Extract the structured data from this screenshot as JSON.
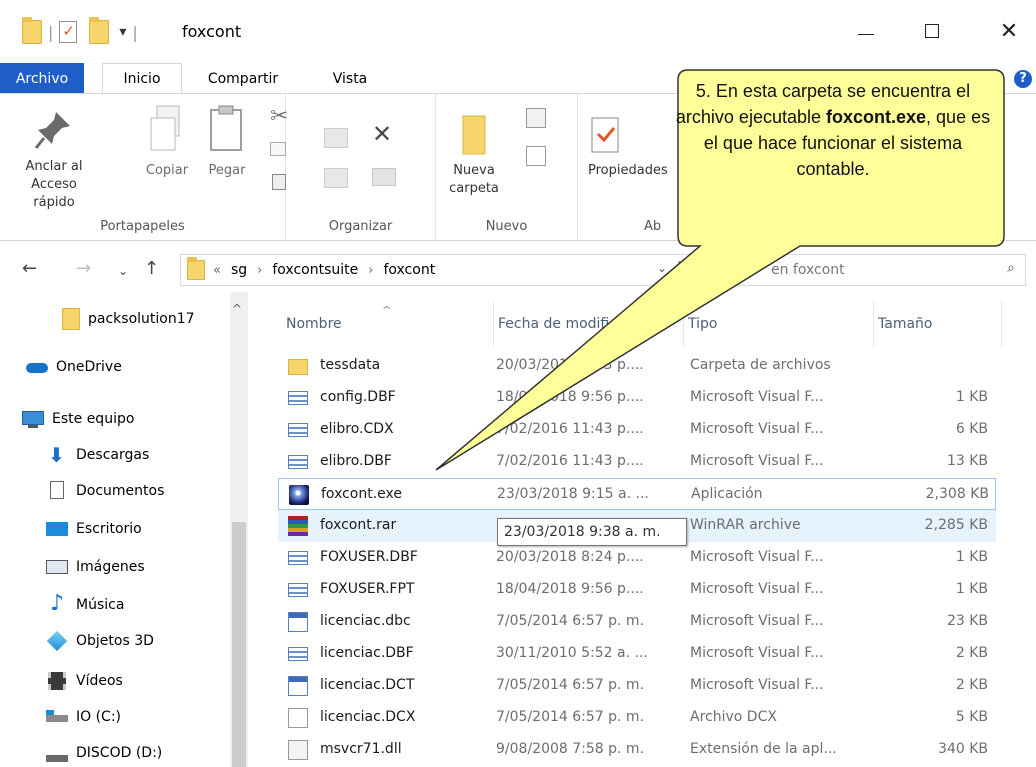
{
  "window": {
    "title": "foxcont",
    "qa_dropdown": "▾"
  },
  "tabs": [
    "Archivo",
    "Inicio",
    "Compartir",
    "Vista"
  ],
  "ribbon": {
    "pin_label_1": "Anclar al",
    "pin_label_2": "Acceso rápido",
    "copy": "Copiar",
    "paste": "Pegar",
    "group_clipboard": "Portapapeles",
    "group_organize": "Organizar",
    "new_folder_1": "Nueva",
    "new_folder_2": "carpeta",
    "group_new": "Nuevo",
    "properties": "Propiedades",
    "group_open_partial": "Ab"
  },
  "address": {
    "overflow": "«",
    "crumbs": [
      "sg",
      "foxcontsuite",
      "foxcont"
    ],
    "search_placeholder": "en foxcont"
  },
  "nav": [
    {
      "label": "packsolution17",
      "icon": "folder-icon"
    },
    {
      "label": "OneDrive",
      "icon": "cloud-icon"
    },
    {
      "label": "Este equipo",
      "icon": "computer-icon"
    },
    {
      "label": "Descargas",
      "icon": "download-icon"
    },
    {
      "label": "Documentos",
      "icon": "documents-icon"
    },
    {
      "label": "Escritorio",
      "icon": "desktop-icon"
    },
    {
      "label": "Imágenes",
      "icon": "pictures-icon"
    },
    {
      "label": "Música",
      "icon": "music-icon"
    },
    {
      "label": "Objetos 3D",
      "icon": "3d-objects-icon"
    },
    {
      "label": "Vídeos",
      "icon": "videos-icon"
    },
    {
      "label": "IO (C:)",
      "icon": "drive-icon"
    },
    {
      "label": "DISCOD (D:)",
      "icon": "drive-icon"
    }
  ],
  "columns": {
    "name": "Nombre",
    "date": "Fecha de modifi",
    "type": "Tipo",
    "size": "Tamaño"
  },
  "files": [
    {
      "name": "tessdata",
      "date": "20/03/2018 8:23 p....",
      "type": "Carpeta de archivos",
      "size": "",
      "icon": "folder"
    },
    {
      "name": "config.DBF",
      "date": "18/04/2018 9:56 p....",
      "type": "Microsoft Visual F...",
      "size": "1 KB",
      "icon": "dbf"
    },
    {
      "name": "elibro.CDX",
      "date": "7/02/2016 11:43 p....",
      "type": "Microsoft Visual F...",
      "size": "6 KB",
      "icon": "dbf"
    },
    {
      "name": "elibro.DBF",
      "date": "7/02/2016 11:43 p....",
      "type": "Microsoft Visual F...",
      "size": "13 KB",
      "icon": "dbf"
    },
    {
      "name": "foxcont.exe",
      "date": "23/03/2018 9:15 a. ...",
      "type": "Aplicación",
      "size": "2,308 KB",
      "icon": "exe"
    },
    {
      "name": "foxcont.rar",
      "date": "23/03/2018 9:38 a. m.",
      "type": "WinRAR archive",
      "size": "2,285 KB",
      "icon": "rar"
    },
    {
      "name": "FOXUSER.DBF",
      "date": "20/03/2018 8:24 p....",
      "type": "Microsoft Visual F...",
      "size": "1 KB",
      "icon": "dbf"
    },
    {
      "name": "FOXUSER.FPT",
      "date": "18/04/2018 9:56 p....",
      "type": "Microsoft Visual F...",
      "size": "1 KB",
      "icon": "dbf"
    },
    {
      "name": "licenciac.dbc",
      "date": "7/05/2014 6:57 p. m.",
      "type": "Microsoft Visual F...",
      "size": "23 KB",
      "icon": "dbc"
    },
    {
      "name": "licenciac.DBF",
      "date": "30/11/2010 5:52 a. ...",
      "type": "Microsoft Visual F...",
      "size": "2 KB",
      "icon": "dbf"
    },
    {
      "name": "licenciac.DCT",
      "date": "7/05/2014 6:57 p. m.",
      "type": "Microsoft Visual F...",
      "size": "2 KB",
      "icon": "dbc"
    },
    {
      "name": "licenciac.DCX",
      "date": "7/05/2014 6:57 p. m.",
      "type": "Archivo DCX",
      "size": "5 KB",
      "icon": "dcx"
    },
    {
      "name": "msvcr71.dll",
      "date": "9/08/2008 7:58 p. m.",
      "type": "Extensión de la apl...",
      "size": "340 KB",
      "icon": "dll"
    }
  ],
  "tooltip": "23/03/2018 9:38 a. m.",
  "callout": {
    "line1": "5. En esta carpeta se encuentra el archivo ejecutable",
    "bold": "foxcont.exe",
    "line2": ", que es el que hace funcionar el sistema contable.",
    "fill": "#ffff99",
    "stroke": "#333333"
  },
  "colors": {
    "file_tab": "#1f5ec8",
    "selection_border": "#99c4ee",
    "hover_row": "#e6f2fc"
  }
}
